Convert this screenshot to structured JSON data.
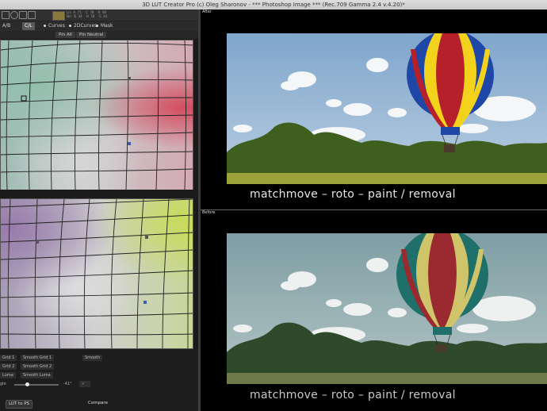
{
  "window": {
    "title": "3D LUT Creator Pro (c) Oleg Sharonov - *** Photoshop Image *** (Rec.709 Gamma 2.4 v.4.20)*"
  },
  "toolbar": {
    "readout": "Lrc  A  71    C  78    R  48\nNrc  B  44    H  78    G  44"
  },
  "tabs": [
    {
      "label": "A/B",
      "active": false
    },
    {
      "label": "C/L",
      "active": true
    },
    {
      "label": "Curves",
      "active": false
    },
    {
      "label": "2DCurves",
      "active": false
    },
    {
      "label": "Mask",
      "active": false
    }
  ],
  "pins": {
    "pin_all": "Pin All",
    "pin_neutral": "Pin Neutral"
  },
  "controls": {
    "grid1": "Grid 1",
    "grid2": "Grid 2",
    "luma": "Luma",
    "smooth_grid1": "Smooth Grid 1",
    "smooth_grid2": "Smooth Grid 2",
    "smooth_luma": "Smooth Luma",
    "smooth": "Smooth",
    "angle_label": "gle",
    "angle_value": "-41°",
    "lut_to_ps": "LUT to PS",
    "compare": "Compare"
  },
  "viewer": {
    "after_label": "After",
    "before_label": "Before",
    "caption": "matchmove – roto – paint / removal"
  },
  "colors": {
    "balloon_red": "#b6202a",
    "balloon_yellow": "#f2d21b",
    "balloon_blue": "#1f47a8",
    "balloon_teal": "#1f6f6a",
    "sky_after": "#8fb2d4",
    "sky_before": "#8aa7a9"
  }
}
